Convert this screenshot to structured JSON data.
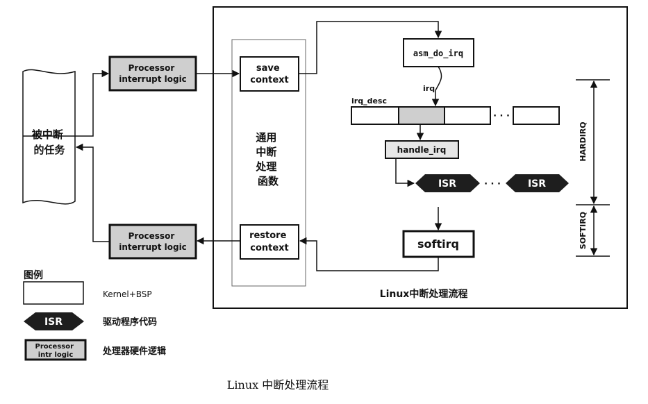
{
  "task_block": {
    "label": "被中断的任务"
  },
  "processor_logic": {
    "top_label": "Processor interrupt logic",
    "bottom_label": "Processor interrupt logic"
  },
  "context": {
    "save": "save context",
    "restore": "restore context"
  },
  "generic_handler": {
    "label": "通用中断处理函数"
  },
  "flow": {
    "asm_do_irq": "asm_do_irq",
    "irq_arrow": "irq",
    "irq_desc": "irq_desc",
    "handle_irq": "handle_irq",
    "isr_1": "ISR",
    "isr_2": "ISR",
    "ellipsis_desc": "· · ·",
    "ellipsis_isr": "· · ·",
    "softirq": "softirq",
    "hardirq_side": "HARDIRQ",
    "softirq_side": "SOFTIRQ"
  },
  "panel_caption": "Linux中断处理流程",
  "legend": {
    "title": "图例",
    "kernel_bsp": "Kernel+BSP",
    "isr_shape_label": "ISR",
    "isr_text": "驱动程序代码",
    "proc_shape_label": "Processor intr logic",
    "proc_text": "处理器硬件逻辑"
  },
  "figure_caption": "Linux 中断处理流程",
  "colors": {
    "line": "#111111",
    "gray_fill": "#cfcfcf",
    "light_fill": "#e6e6e6",
    "hex_fill": "#1e1e1e",
    "hex_text": "#ffffff"
  }
}
